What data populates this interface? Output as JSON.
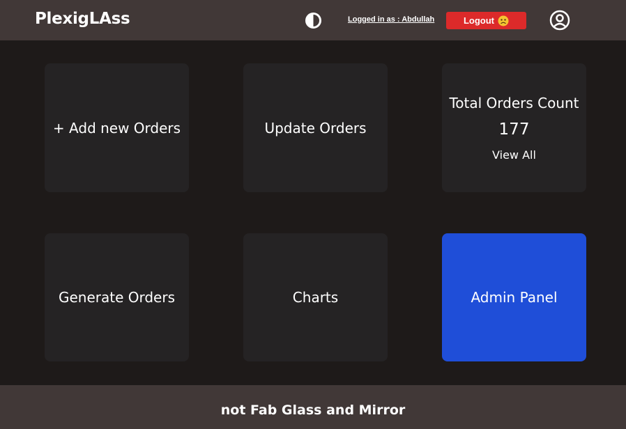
{
  "navbar": {
    "brand": "PlexigLAss",
    "theme_toggle_icon": "contrast-icon",
    "logged_in_text": "Logged in as : Abdullah",
    "logout_label": "Logout",
    "logout_emoji_icon": "worried-face-icon",
    "profile_icon": "user-circle-icon"
  },
  "cards": {
    "add_orders": "+ Add new Orders",
    "update_orders": "Update Orders",
    "total_orders": {
      "title": "Total Orders Count",
      "count": "177",
      "view_all": "View All"
    },
    "generate_orders": "Generate Orders",
    "charts": "Charts",
    "admin_panel": "Admin Panel"
  },
  "footer": {
    "text": "not Fab Glass and Mirror"
  },
  "colors": {
    "navbar_bg": "#413837",
    "page_bg": "#1e1a19",
    "card_bg": "#252324",
    "admin_card_bg": "#1f4ed8",
    "logout_bg": "#dc2a2a"
  }
}
